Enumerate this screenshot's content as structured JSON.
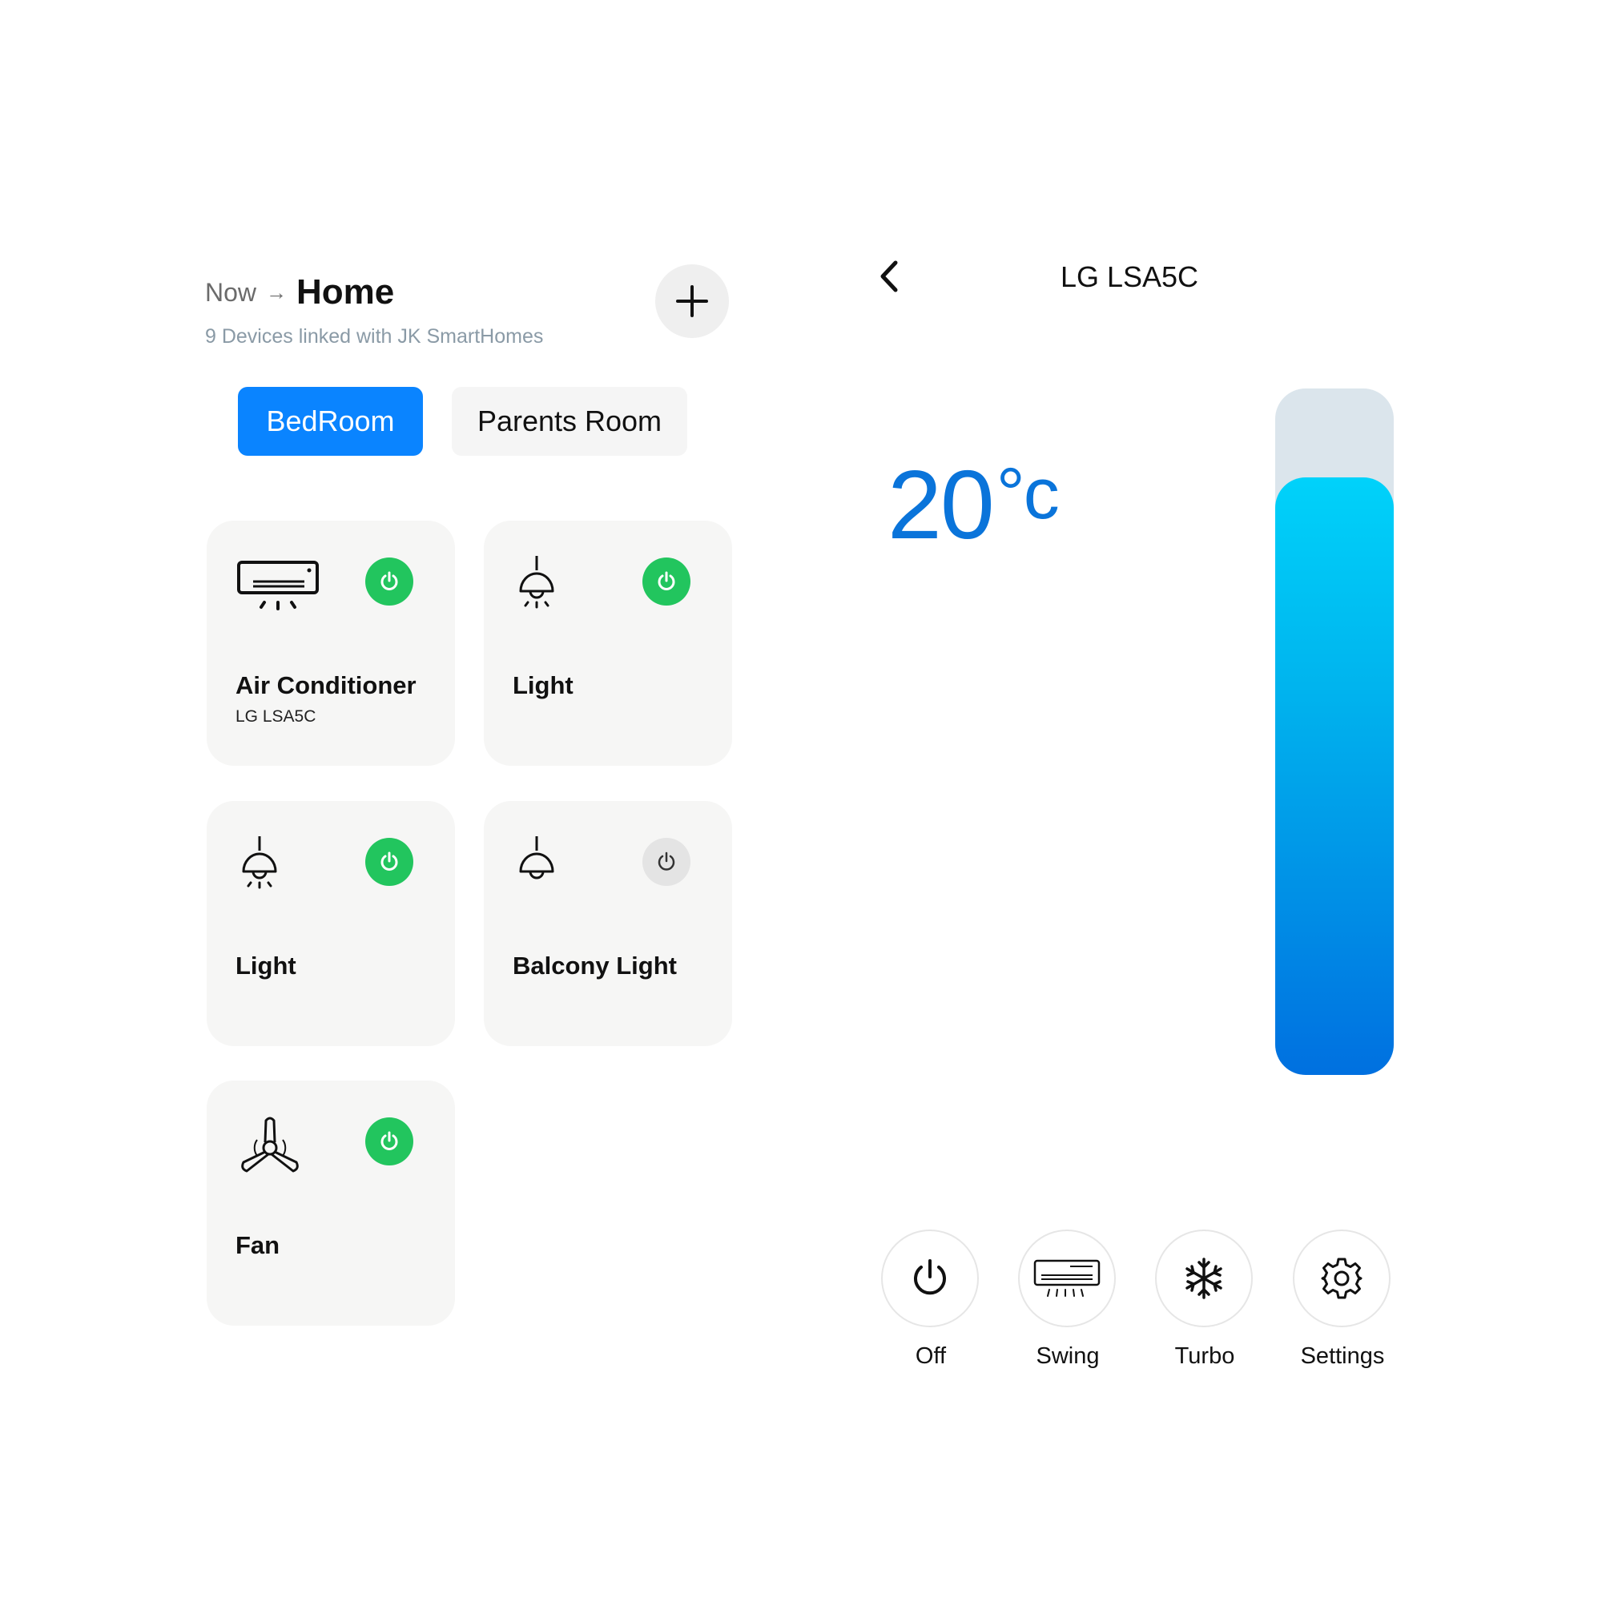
{
  "header": {
    "breadcrumb_now": "Now",
    "breadcrumb_arrow": "→",
    "breadcrumb_home": "Home",
    "subtitle": "9 Devices linked with JK SmartHomes",
    "add_icon": "plus-icon"
  },
  "rooms": [
    {
      "label": "BedRoom",
      "active": true
    },
    {
      "label": "Parents Room",
      "active": false
    }
  ],
  "devices": [
    {
      "name": "Air Conditioner",
      "model": "LG LSA5C",
      "icon": "air-conditioner-icon",
      "power": "on"
    },
    {
      "name": "Light",
      "model": "",
      "icon": "pendant-light-icon",
      "power": "on"
    },
    {
      "name": "Light",
      "model": "",
      "icon": "pendant-light-icon",
      "power": "on"
    },
    {
      "name": "Balcony Light",
      "model": "",
      "icon": "pendant-light-icon",
      "power": "off"
    },
    {
      "name": "Fan",
      "model": "",
      "icon": "ceiling-fan-icon",
      "power": "on"
    }
  ],
  "detail": {
    "title": "LG LSA5C",
    "back_icon": "chevron-left-icon",
    "temperature_value": "20",
    "temperature_unit": "°c",
    "slider_level_percent": 87
  },
  "controls": [
    {
      "label": "Off",
      "icon": "power-icon"
    },
    {
      "label": "Swing",
      "icon": "ac-swing-icon"
    },
    {
      "label": "Turbo",
      "icon": "snowflake-icon"
    },
    {
      "label": "Settings",
      "icon": "gear-icon"
    }
  ],
  "colors": {
    "accent": "#0a84ff",
    "power_on": "#22c55e",
    "power_off": "#e4e4e4",
    "temperature": "#0a74da",
    "slider_top": "#00d2fa",
    "slider_bottom": "#0070e0",
    "slider_track": "#dbe5ec"
  }
}
